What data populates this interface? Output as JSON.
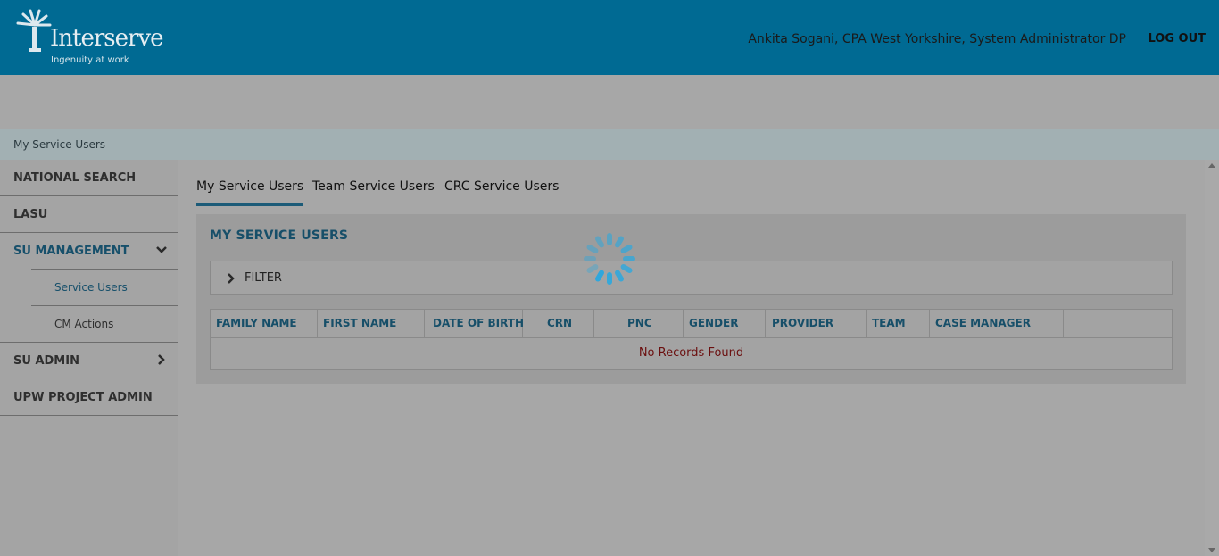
{
  "header": {
    "logo_text": "Interserve",
    "logo_tagline": "Ingenuity at work",
    "user_info": "Ankita Sogani, CPA West Yorkshire, System Administrator DP",
    "logout_label": "LOG OUT"
  },
  "breadcrumb": "My Service Users",
  "sidebar": {
    "items": [
      {
        "label": "NATIONAL SEARCH"
      },
      {
        "label": "LASU"
      },
      {
        "label": "SU MANAGEMENT"
      },
      {
        "label": "SU ADMIN"
      },
      {
        "label": "UPW PROJECT ADMIN"
      }
    ],
    "sub_items": [
      {
        "label": "Service Users"
      },
      {
        "label": "CM Actions"
      }
    ]
  },
  "tabs": [
    {
      "label": "My Service Users",
      "active": true
    },
    {
      "label": "Team Service Users",
      "active": false
    },
    {
      "label": "CRC Service Users",
      "active": false
    }
  ],
  "panel": {
    "title": "MY SERVICE USERS",
    "filter_label": "FILTER",
    "columns": [
      "FAMILY NAME",
      "FIRST NAME",
      "DATE OF BIRTH",
      "CRN",
      "PNC",
      "GENDER",
      "PROVIDER",
      "TEAM",
      "CASE MANAGER"
    ],
    "empty_message": "No Records Found"
  },
  "colors": {
    "header_bg": "#006a93",
    "accent": "#174f69",
    "spinner": "#29a8e0"
  }
}
